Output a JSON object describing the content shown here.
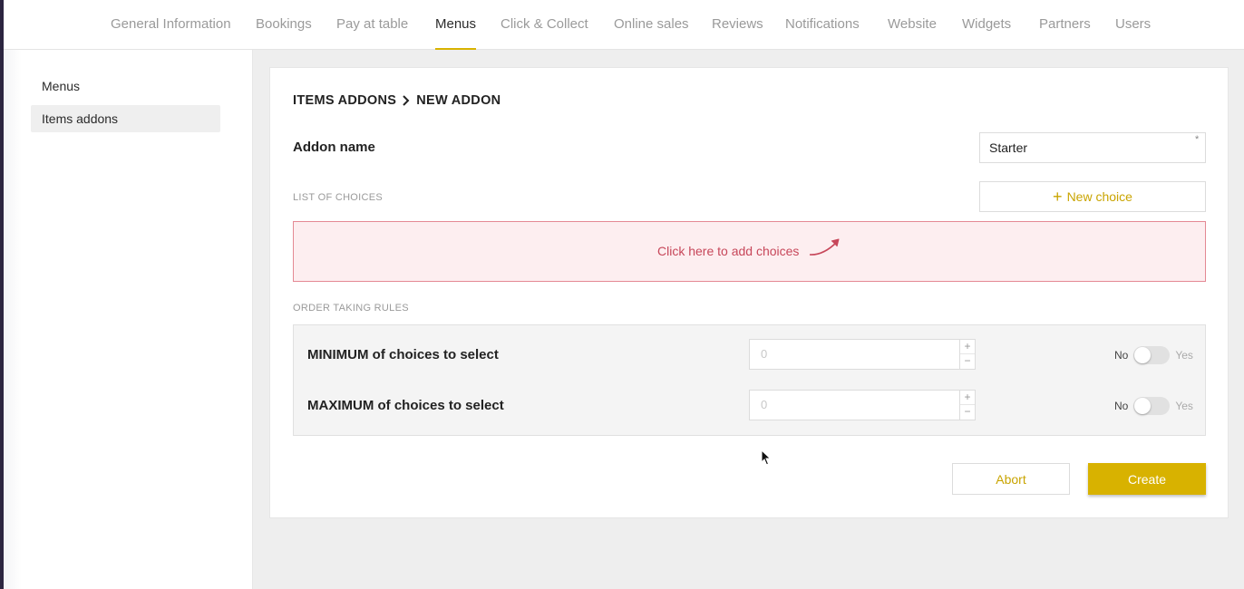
{
  "nav": {
    "tabs": [
      {
        "label": "General Information"
      },
      {
        "label": "Bookings"
      },
      {
        "label": "Pay at table"
      },
      {
        "label": "Menus"
      },
      {
        "label": "Click & Collect"
      },
      {
        "label": "Online sales"
      },
      {
        "label": "Reviews"
      },
      {
        "label": "Notifications"
      },
      {
        "label": "Website"
      },
      {
        "label": "Widgets"
      },
      {
        "label": "Partners"
      },
      {
        "label": "Users"
      }
    ],
    "active": "Menus"
  },
  "sidebar": {
    "items": [
      {
        "label": "Menus"
      },
      {
        "label": "Items addons"
      }
    ],
    "active": "Items addons"
  },
  "breadcrumb": {
    "parent": "ITEMS ADDONS",
    "current": "NEW ADDON"
  },
  "form": {
    "addon_name_label": "Addon name",
    "addon_name_value": "Starter",
    "required_mark": "*",
    "choices_section_title": "LIST OF CHOICES",
    "new_choice_label": "New choice",
    "add_choices_hint": "Click here to add choices",
    "rules_section_title": "ORDER TAKING RULES",
    "rules": [
      {
        "label": "MINIMUM of choices to select",
        "value": "0",
        "toggle_no": "No",
        "toggle_yes": "Yes",
        "enabled": false
      },
      {
        "label": "MAXIMUM of choices to select",
        "value": "0",
        "toggle_no": "No",
        "toggle_yes": "Yes",
        "enabled": false
      }
    ]
  },
  "actions": {
    "abort_label": "Abort",
    "create_label": "Create"
  },
  "colors": {
    "accent": "#d8b200",
    "danger_text": "#c7475a",
    "danger_bg": "#fdeef0"
  },
  "icons": {
    "breadcrumb_separator": "chevron-right-icon",
    "new_choice": "plus-icon",
    "choices_hint": "curved-arrow-icon",
    "stepper_up": "plus-icon",
    "stepper_down": "minus-icon"
  }
}
